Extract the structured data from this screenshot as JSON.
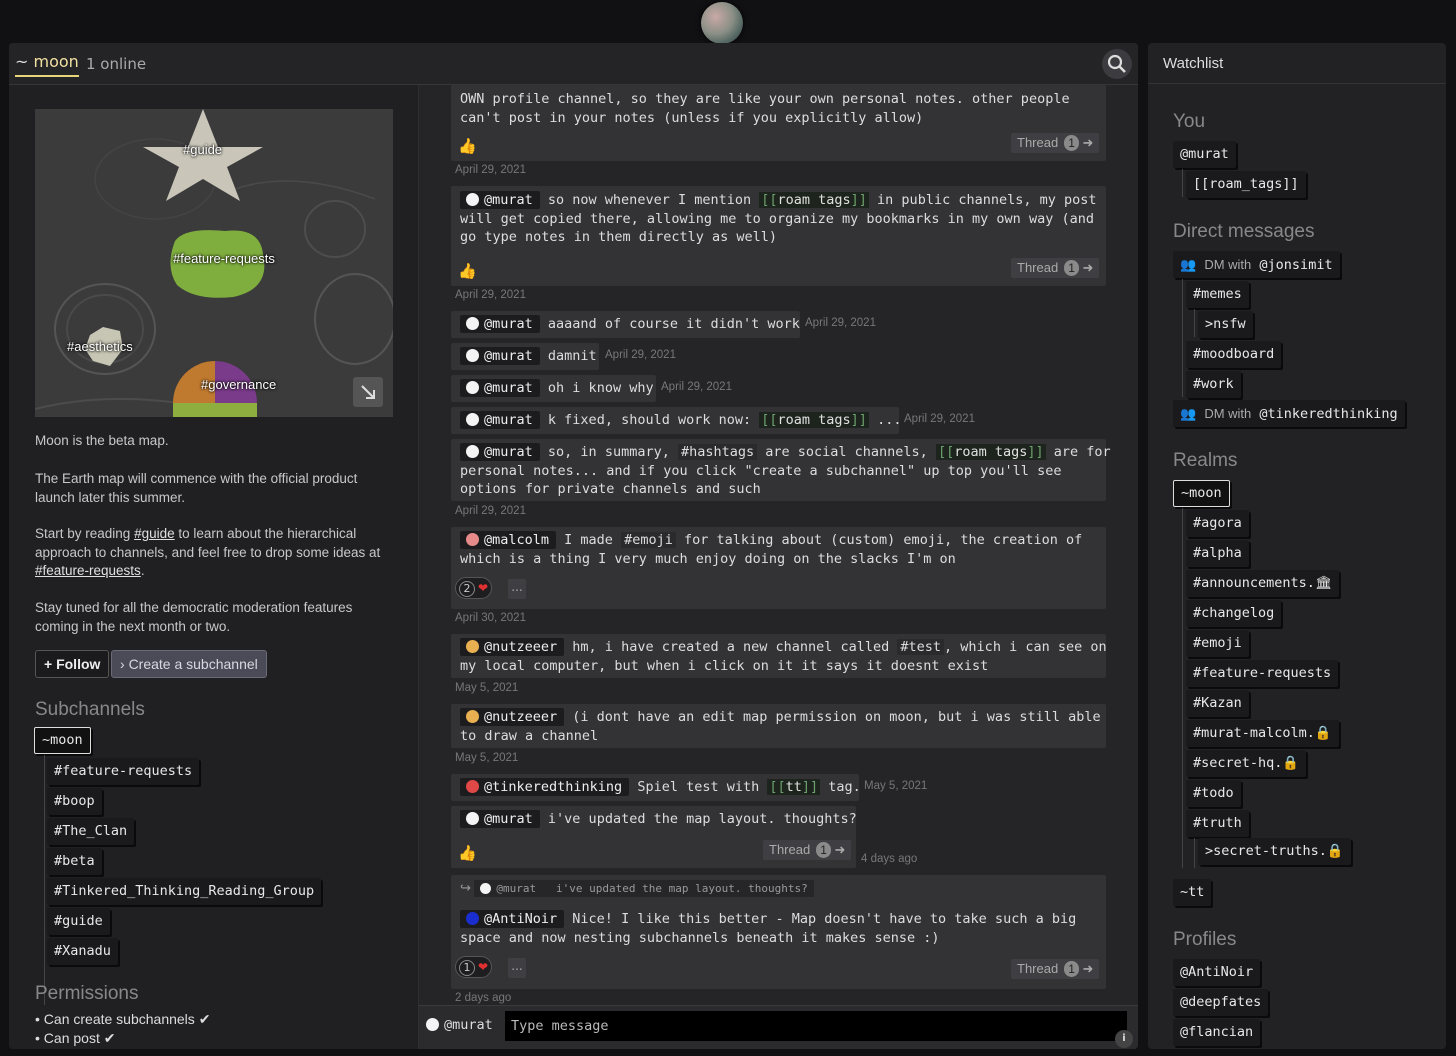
{
  "header": {
    "tilde": "~",
    "realm": "moon",
    "online": "1 online"
  },
  "map": {
    "labels": [
      "#guide",
      "#feature-requests",
      "#aesthetics",
      "#governance"
    ]
  },
  "about": {
    "p1": "Moon is the beta map.",
    "p2": "The Earth map will commence with the official product launch later this summer.",
    "p3_pre": "Start by reading ",
    "p3_link1": "#guide",
    "p3_mid": " to learn about the hierarchical approach to channels, and feel free to drop some ideas at ",
    "p3_link2": "#feature-requests",
    "p3_post": ".",
    "p4": "Stay tuned for all the democratic moderation features coming in the next month or two."
  },
  "actions": {
    "follow": "Follow",
    "create_subchannel": "Create a subchannel"
  },
  "subchannels": {
    "title": "Subchannels",
    "root": "~moon",
    "items": [
      "#feature-requests",
      "#boop",
      "#The_Clan",
      "#beta",
      "#Tinkered_Thinking_Reading_Group",
      "#guide",
      "#Xanadu"
    ]
  },
  "permissions": {
    "title": "Permissions",
    "items": [
      "Can create subchannels",
      "Can post"
    ]
  },
  "feed": {
    "m0": {
      "l1": "OWN profile channel, so they are like your own personal notes. other people",
      "l2": "can't post in your notes (unless if you explicitly allow)",
      "thread": "Thread",
      "count": "1",
      "date": "April 29, 2021"
    },
    "m1": {
      "user": "@murat",
      "t1": " so now whenever I mention ",
      "roam": "roam tags",
      "t2": " in public channels, my post",
      "l2": "will get copied there, allowing me to organize my bookmarks in my own way (and",
      "l3": "go type notes in them directly as well)",
      "thread": "Thread",
      "count": "1",
      "date": "April 29, 2021"
    },
    "m2": {
      "user": "@murat",
      "text": "aaaand of course it didn't work",
      "date": "April 29, 2021"
    },
    "m3": {
      "user": "@murat",
      "text": "damnit",
      "date": "April 29, 2021"
    },
    "m4": {
      "user": "@murat",
      "text": "oh i know why",
      "date": "April 29, 2021"
    },
    "m5": {
      "user": "@murat",
      "t1": "k fixed, should work now: ",
      "roam": "roam tags",
      "t2": " ...",
      "date": "April 29, 2021"
    },
    "m6": {
      "user": "@murat",
      "t1": "so, in summary, ",
      "tag": "#hashtags",
      "t2": " are social channels, ",
      "roam": "roam tags",
      "t3": " are for",
      "l2": "personal notes... and if you click \"create a subchannel\" up top you'll see",
      "l3": "options for private channels and such",
      "date": "April 29, 2021"
    },
    "m7": {
      "user": "@malcolm",
      "t1": "I made ",
      "tag": "#emoji",
      "t2": " for talking about (custom) emoji, the creation of",
      "l2": "which is a thing I very much enjoy doing on the slacks I'm on",
      "react_count": "2",
      "more": "...",
      "date": "April 30, 2021"
    },
    "m8": {
      "user": "@nutzeeer",
      "t1": "hm, i have created a new channel called ",
      "tag": "#test",
      "t2": ", which i can see on",
      "l2": "my local computer, but when i click on it it says it doesnt exist",
      "date": "May 5, 2021"
    },
    "m9": {
      "user": "@nutzeeer",
      "t1": "(i dont have an edit map permission on moon, but i was still able",
      "l2": "to draw a channel",
      "date": "May 5, 2021"
    },
    "m10": {
      "user": "@tinkeredthinking",
      "t1": "Spiel test with ",
      "roam": "tt",
      "t2": " tag.",
      "date": "May 5, 2021"
    },
    "m11": {
      "user": "@murat",
      "text": "i've updated the map layout. thoughts?",
      "thread": "Thread",
      "count": "1",
      "date": "4 days ago"
    },
    "m12": {
      "reply_user": "@murat",
      "reply_text": "i've updated the map layout. thoughts?",
      "user": "@AntiNoir",
      "t1": "Nice! I like this better - Map doesn't have to take such a big",
      "l2": "space and now nesting subchannels beneath it makes sense :)",
      "react_count": "1",
      "more": "...",
      "thread": "Thread",
      "count": "1",
      "date": "2 days ago"
    }
  },
  "composer": {
    "user": "@murat",
    "placeholder": "Type message",
    "info": "i"
  },
  "watchlist": {
    "title": "Watchlist",
    "you": {
      "title": "You",
      "user": "@murat",
      "child": "[[roam_tags]]"
    },
    "dms": {
      "title": "Direct messages",
      "dm_label": "DM with",
      "dm1": "@jonsimit",
      "dm1_items": [
        "#memes",
        ">nsfw",
        "#moodboard",
        "#work"
      ],
      "dm2": "@tinkeredthinking"
    },
    "realms": {
      "title": "Realms",
      "root": "~moon",
      "items": [
        "#agora",
        "#alpha",
        "#announcements.",
        "#changelog",
        "#emoji",
        "#feature-requests",
        "#Kazan",
        "#murat-malcolm.",
        "#secret-hq.",
        "#todo",
        "#truth",
        ">secret-truths."
      ],
      "tt": "~tt"
    },
    "profiles": {
      "title": "Profiles",
      "items": [
        "@AntiNoir",
        "@deepfates",
        "@flancian"
      ]
    }
  },
  "colors": {
    "accent": "#e8d27a",
    "background": "#111114",
    "panel": "#252528",
    "roam_bracket": "#6da06d",
    "heart": "#e03030"
  }
}
